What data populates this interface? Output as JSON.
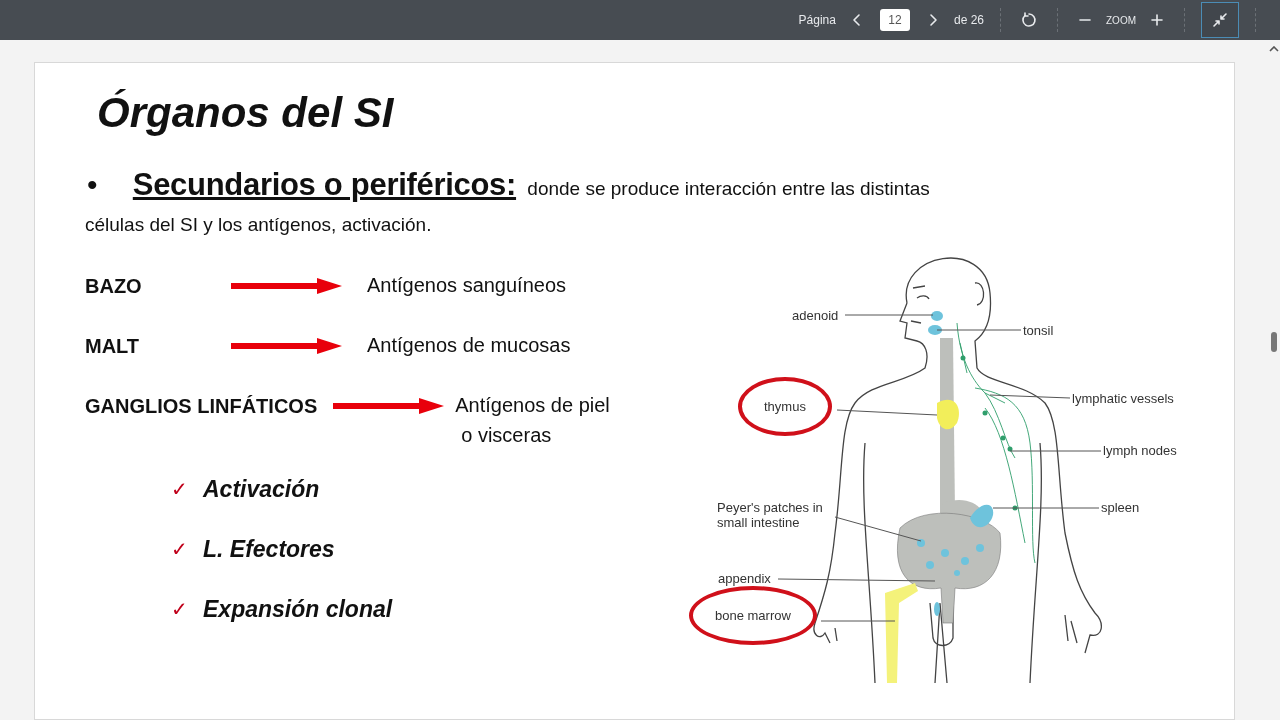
{
  "toolbar": {
    "page_label": "Página",
    "page_field": "12",
    "page_total": "de 26",
    "zoom_label": "ZOOM",
    "fullscreen_active": true
  },
  "slide": {
    "title": "Órganos del SI",
    "bullet": {
      "symbol": "•",
      "heading": "Secundarios o periféricos:",
      "text": "donde se produce interacción entre las distintas células del SI y los antígenos, activación."
    },
    "mappings": [
      {
        "term": "BAZO",
        "target_lines": [
          "Antígenos sanguíneos"
        ]
      },
      {
        "term": "MALT",
        "target_lines": [
          "Antígenos de mucosas"
        ]
      },
      {
        "term": "GANGLIOS LINFÁTICOS",
        "target_lines": [
          "Antígenos de piel",
          "o visceras"
        ]
      }
    ],
    "checks": [
      {
        "mark": "✓",
        "text": "Activación"
      },
      {
        "mark": "✓",
        "text": "L. Efectores"
      },
      {
        "mark": "✓",
        "text": "Expansión clonal"
      }
    ],
    "diagram": {
      "labels": [
        {
          "text": "adenoid",
          "circled": false
        },
        {
          "text": "tonsil",
          "circled": false
        },
        {
          "text": "thymus",
          "circled": true
        },
        {
          "text": "lymphatic vessels",
          "circled": false
        },
        {
          "text": "lymph nodes",
          "circled": false
        },
        {
          "text": "Peyer's patches in\nsmall intestine",
          "circled": false
        },
        {
          "text": "spleen",
          "circled": false
        },
        {
          "text": "appendix",
          "circled": false
        },
        {
          "text": "bone marrow",
          "circled": true
        }
      ]
    }
  }
}
